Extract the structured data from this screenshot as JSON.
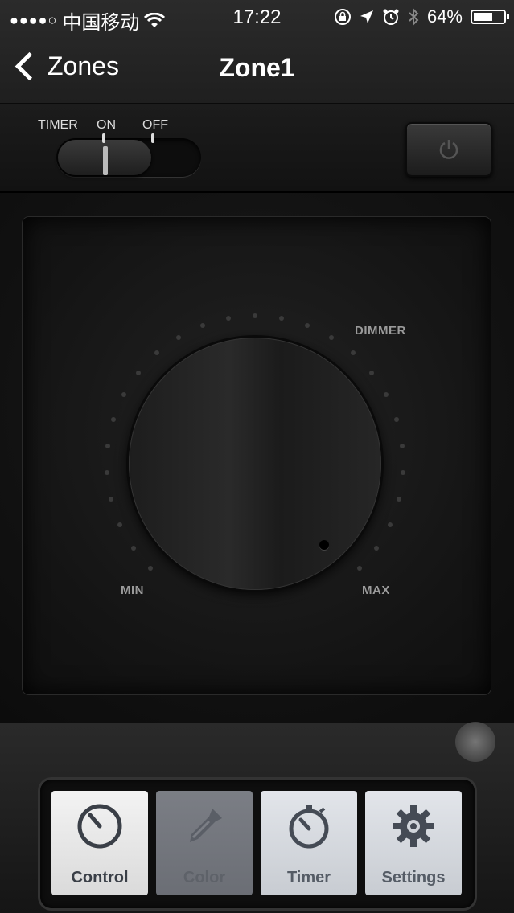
{
  "status_bar": {
    "signal": "●●●●○",
    "carrier": "中国移动",
    "time": "17:22",
    "battery": "64%",
    "battery_level": 0.64
  },
  "nav": {
    "back_label": "Zones",
    "title": "Zone1"
  },
  "timer": {
    "label": "TIMER",
    "on_label": "ON",
    "off_label": "OFF",
    "state": "ON"
  },
  "dial": {
    "title": "DIMMER",
    "min_label": "MIN",
    "max_label": "MAX"
  },
  "tabs": [
    {
      "label": "Control",
      "icon": "gauge-icon",
      "state": "active"
    },
    {
      "label": "Color",
      "icon": "eyedropper-icon",
      "state": "disabled"
    },
    {
      "label": "Timer",
      "icon": "stopwatch-icon",
      "state": "normal"
    },
    {
      "label": "Settings",
      "icon": "gear-icon",
      "state": "normal"
    }
  ],
  "colors": {
    "accent_text": "#ffffff",
    "dial_label": "#9a9a9a",
    "tab_active": "#f0f0f0",
    "tab_disabled": "#74777e",
    "tab_normal": "#d6d9de"
  }
}
